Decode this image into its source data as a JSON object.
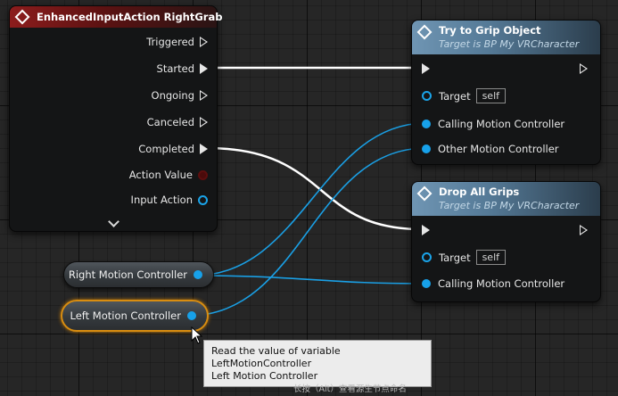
{
  "colors": {
    "event_header": "#8c1c1c",
    "function_header": "#6f95b3",
    "object_pin": "#17a1ea",
    "exec_wire": "#ffffff",
    "selection_outline": "#d98d10"
  },
  "event_node": {
    "title": "EnhancedInputAction RightGrab",
    "icon": "event-diamond-icon",
    "pins": {
      "triggered": "Triggered",
      "started": "Started",
      "ongoing": "Ongoing",
      "canceled": "Canceled",
      "completed": "Completed",
      "action_value": "Action Value",
      "input_action": "Input Action"
    }
  },
  "grip_node": {
    "title": "Try to Grip Object",
    "subtitle": "Target is BP My VRCharacter",
    "icon": "function-diamond-icon",
    "target_label": "Target",
    "target_value": "self",
    "calling_label": "Calling Motion Controller",
    "other_label": "Other Motion Controller"
  },
  "drop_node": {
    "title": "Drop All Grips",
    "subtitle": "Target is BP My VRCharacter",
    "icon": "function-diamond-icon",
    "target_label": "Target",
    "target_value": "self",
    "calling_label": "Calling Motion Controller"
  },
  "variables": {
    "right": "Right Motion Controller",
    "left": "Left Motion Controller"
  },
  "tooltip": {
    "line1": "Read the value of variable LeftMotionController",
    "line2": "Left Motion Controller",
    "hint": "长按（Alt）查看源生节点命名"
  }
}
